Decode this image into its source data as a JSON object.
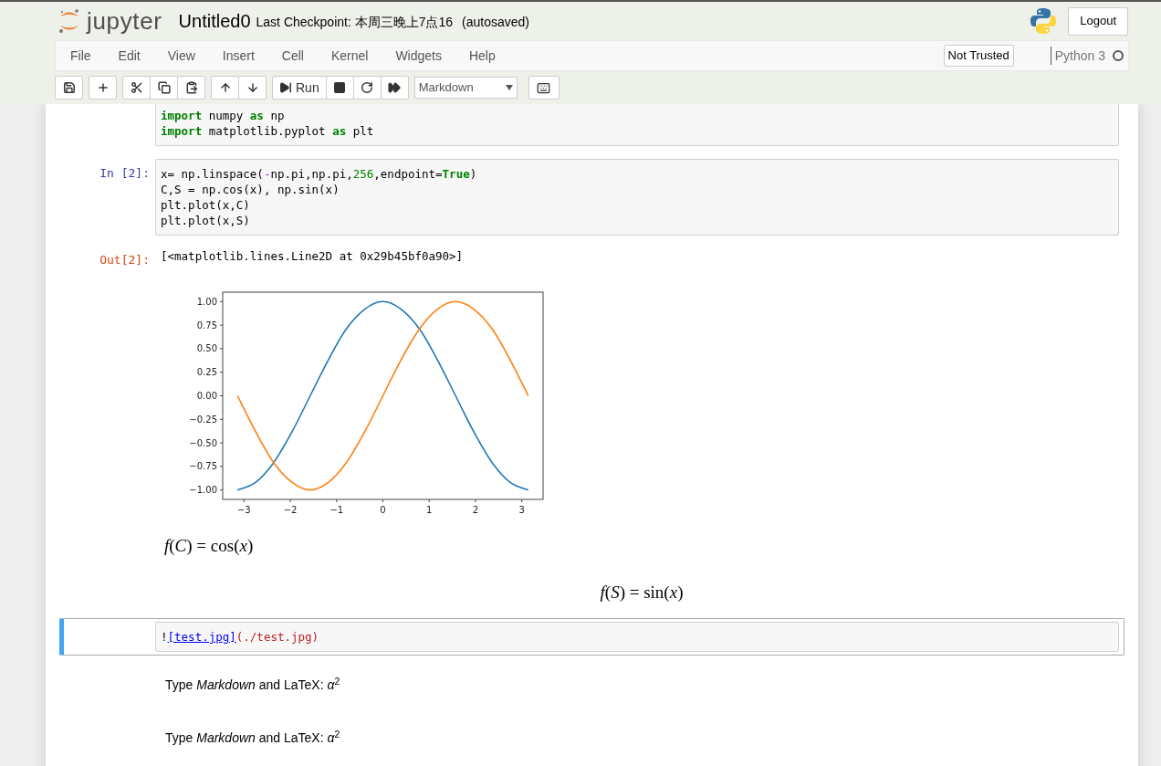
{
  "header": {
    "logo_text": "jupyter",
    "notebook_name": "Untitled0",
    "checkpoint": "Last Checkpoint: 本周三晚上7点16",
    "autosave": "(autosaved)",
    "logout": "Logout"
  },
  "menu": [
    "File",
    "Edit",
    "View",
    "Insert",
    "Cell",
    "Kernel",
    "Widgets",
    "Help"
  ],
  "trust": "Not Trusted",
  "kernel": {
    "name": "Python 3",
    "busy": false
  },
  "toolbar": [
    [
      {
        "kind": "save"
      }
    ],
    [
      {
        "kind": "plus"
      }
    ],
    [
      {
        "kind": "cut"
      },
      {
        "kind": "copy"
      },
      {
        "kind": "paste"
      }
    ],
    [
      {
        "kind": "up"
      },
      {
        "kind": "down"
      }
    ],
    [
      {
        "kind": "run",
        "label": "Run"
      },
      {
        "kind": "stop"
      },
      {
        "kind": "restart"
      },
      {
        "kind": "fast-forward"
      }
    ]
  ],
  "cell_type": "Markdown",
  "cells": [
    {
      "kind": "code",
      "selected": false,
      "lines": [
        [
          {
            "kind": "kw",
            "text": "import"
          },
          {
            "kind": "plain",
            "text": " numpy "
          },
          {
            "kind": "kw",
            "text": "as"
          },
          {
            "kind": "plain",
            "text": " np"
          }
        ],
        [
          {
            "kind": "kw",
            "text": "import"
          },
          {
            "kind": "plain",
            "text": " matplotlib.pyplot "
          },
          {
            "kind": "kw",
            "text": "as"
          },
          {
            "kind": "plain",
            "text": " plt"
          }
        ]
      ]
    },
    {
      "kind": "code",
      "selected": false,
      "prompt": "In [2]:",
      "lines": [
        [
          {
            "kind": "plain",
            "text": "x= np.linspace("
          },
          {
            "kind": "op",
            "text": "-"
          },
          {
            "kind": "plain",
            "text": "np.pi,np.pi,"
          },
          {
            "kind": "num",
            "text": "256"
          },
          {
            "kind": "plain",
            "text": ",endpoint="
          },
          {
            "kind": "kw",
            "text": "True"
          },
          {
            "kind": "plain",
            "text": ")"
          }
        ],
        [
          {
            "kind": "plain",
            "text": "C,S = np.cos(x), np.sin(x)"
          }
        ],
        [
          {
            "kind": "plain",
            "text": "plt.plot(x,C)"
          }
        ],
        [
          {
            "kind": "plain",
            "text": "plt.plot(x,S)"
          }
        ]
      ]
    },
    {
      "kind": "output",
      "selected": false,
      "prompt": "Out[2]:",
      "text": "[<matplotlib.lines.Line2D at 0x29b45bf0a90>]"
    },
    {
      "kind": "plot",
      "selected": false,
      "chart_data": {
        "type": "line",
        "x": [
          -3.14,
          -2.75,
          -2.36,
          -1.96,
          -1.57,
          -1.18,
          -0.79,
          -0.39,
          0,
          0.39,
          0.79,
          1.18,
          1.57,
          1.96,
          2.36,
          2.75,
          3.14
        ],
        "series": [
          {
            "color": "#1f77b4",
            "values": [
              -1,
              -0.92,
              -0.71,
              -0.38,
              0,
              0.38,
              0.71,
              0.92,
              1,
              0.92,
              0.71,
              0.38,
              0,
              -0.38,
              -0.71,
              -0.92,
              -1
            ]
          },
          {
            "color": "#ff7f0e",
            "values": [
              0,
              -0.38,
              -0.71,
              -0.92,
              -1,
              -0.92,
              -0.71,
              -0.38,
              0,
              0.38,
              0.71,
              0.92,
              1,
              0.92,
              0.71,
              0.38,
              0
            ]
          }
        ],
        "xlim": [
          -3.46,
          3.46
        ],
        "ylim": [
          -1.1,
          1.1
        ],
        "xticks": [
          {
            "value": -3,
            "label": "−3"
          },
          {
            "value": -2,
            "label": "−2"
          },
          {
            "value": -1,
            "label": "−1"
          },
          {
            "value": 0,
            "label": "0"
          },
          {
            "value": 1,
            "label": "1"
          },
          {
            "value": 2,
            "label": "2"
          },
          {
            "value": 3,
            "label": "3"
          }
        ],
        "yticks": [
          {
            "value": 1,
            "label": "1.00"
          },
          {
            "value": 0.75,
            "label": "0.75"
          },
          {
            "value": 0.5,
            "label": "0.50"
          },
          {
            "value": 0.25,
            "label": "0.25"
          },
          {
            "value": 0,
            "label": "0.00"
          },
          {
            "value": -0.25,
            "label": "−0.25"
          },
          {
            "value": -0.5,
            "label": "−0.50"
          },
          {
            "value": -0.75,
            "label": "−0.75"
          },
          {
            "value": -1,
            "label": "−1.00"
          }
        ]
      }
    },
    {
      "kind": "math",
      "selected": false,
      "centered": false,
      "text": "*f*(*C*) = cos(*x*)"
    },
    {
      "kind": "math",
      "selected": false,
      "centered": true,
      "text": "*f*(*S*) = sin(*x*)"
    },
    {
      "kind": "markdown_source",
      "selected": true,
      "lines": [
        [
          {
            "kind": "plain",
            "text": "!"
          },
          {
            "kind": "link",
            "text": "[test.jpg]"
          },
          {
            "kind": "str",
            "text": "(./test.jpg)"
          }
        ]
      ]
    },
    {
      "kind": "markdown",
      "selected": false,
      "text": "Type *Markdown* and LaTeX: *α*$^{2}$"
    },
    {
      "kind": "markdown",
      "selected": false,
      "text": "Type *Markdown* and LaTeX: *α*$^{2}$"
    }
  ]
}
